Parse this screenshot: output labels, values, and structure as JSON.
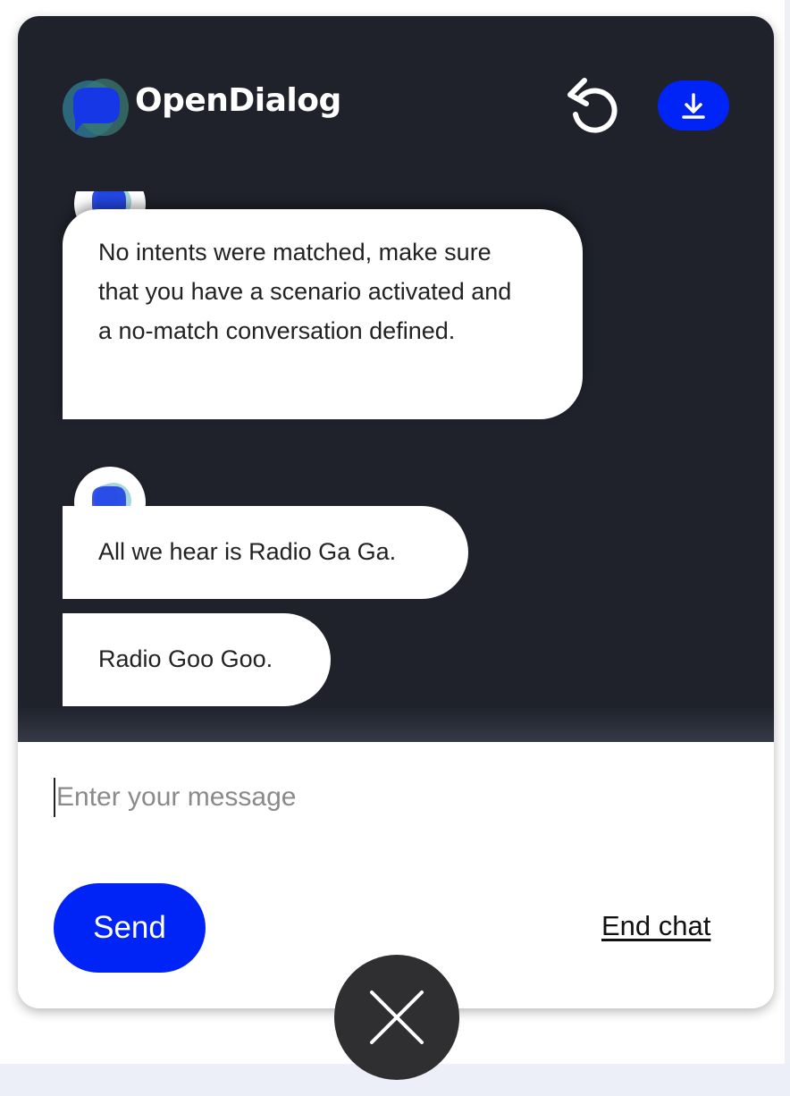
{
  "header": {
    "brand_name": "OpenDialog",
    "restart_icon": "restart-icon",
    "download_icon": "download-icon"
  },
  "messages": [
    {
      "sender": "bot",
      "text": "No intents were matched, make sure that you have a scenario activated and a no-match conversation defined."
    },
    {
      "sender": "bot",
      "text": "All we hear is Radio Ga Ga."
    },
    {
      "sender": "bot",
      "text": "Radio Goo Goo."
    }
  ],
  "composer": {
    "placeholder": "Enter your message",
    "value": "",
    "send_label": "Send",
    "end_chat_label": "End chat"
  },
  "launcher": {
    "close_icon": "close-icon"
  },
  "colors": {
    "header_background": "#1f222b",
    "accent": "#0024f5",
    "close_button": "#2f2f31"
  }
}
